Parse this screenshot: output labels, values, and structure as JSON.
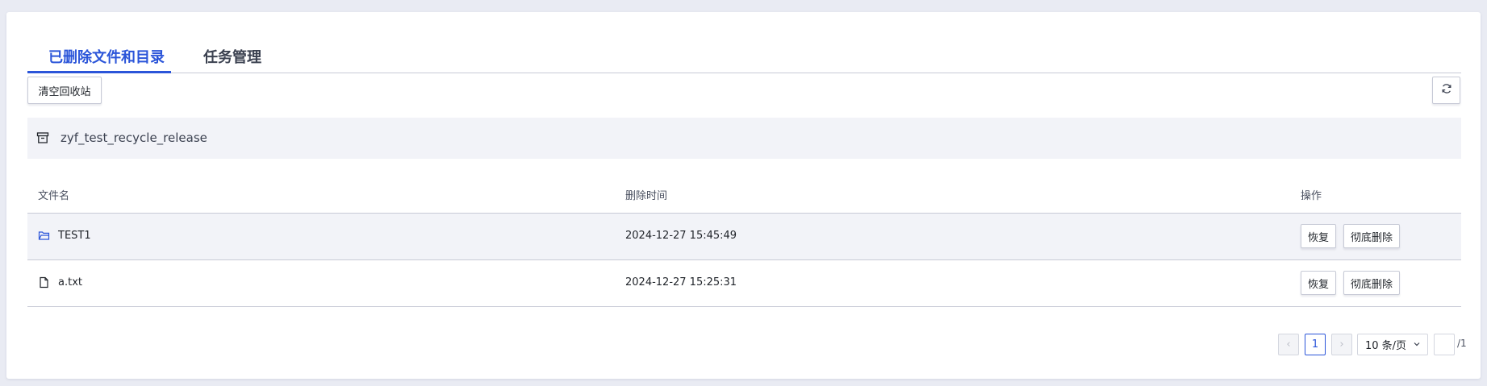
{
  "tabs": [
    {
      "label": "已删除文件和目录",
      "active": true
    },
    {
      "label": "任务管理",
      "active": false
    }
  ],
  "toolbar": {
    "clear_label": "清空回收站",
    "refresh_icon": "refresh-icon"
  },
  "bucket": {
    "icon": "archive-box-icon",
    "name": "zyf_test_recycle_release"
  },
  "table": {
    "columns": [
      "文件名",
      "删除时间",
      "操作"
    ],
    "rows": [
      {
        "icon": "folder-icon",
        "name": "TEST1",
        "deleted_at": "2024-12-27 15:45:49",
        "restore_label": "恢复",
        "delete_label": "彻底删除"
      },
      {
        "icon": "file-icon",
        "name": "a.txt",
        "deleted_at": "2024-12-27 15:25:31",
        "restore_label": "恢复",
        "delete_label": "彻底删除"
      }
    ]
  },
  "pagination": {
    "prev": "‹",
    "current_page": "1",
    "next": "›",
    "page_size": "10 条/页",
    "jump_value": "",
    "total_pages": "/1"
  },
  "colors": {
    "accent": "#2b55d9",
    "border": "#c7cad6",
    "row_highlight": "#f2f3f8",
    "page_bg": "#e9ebf3"
  }
}
